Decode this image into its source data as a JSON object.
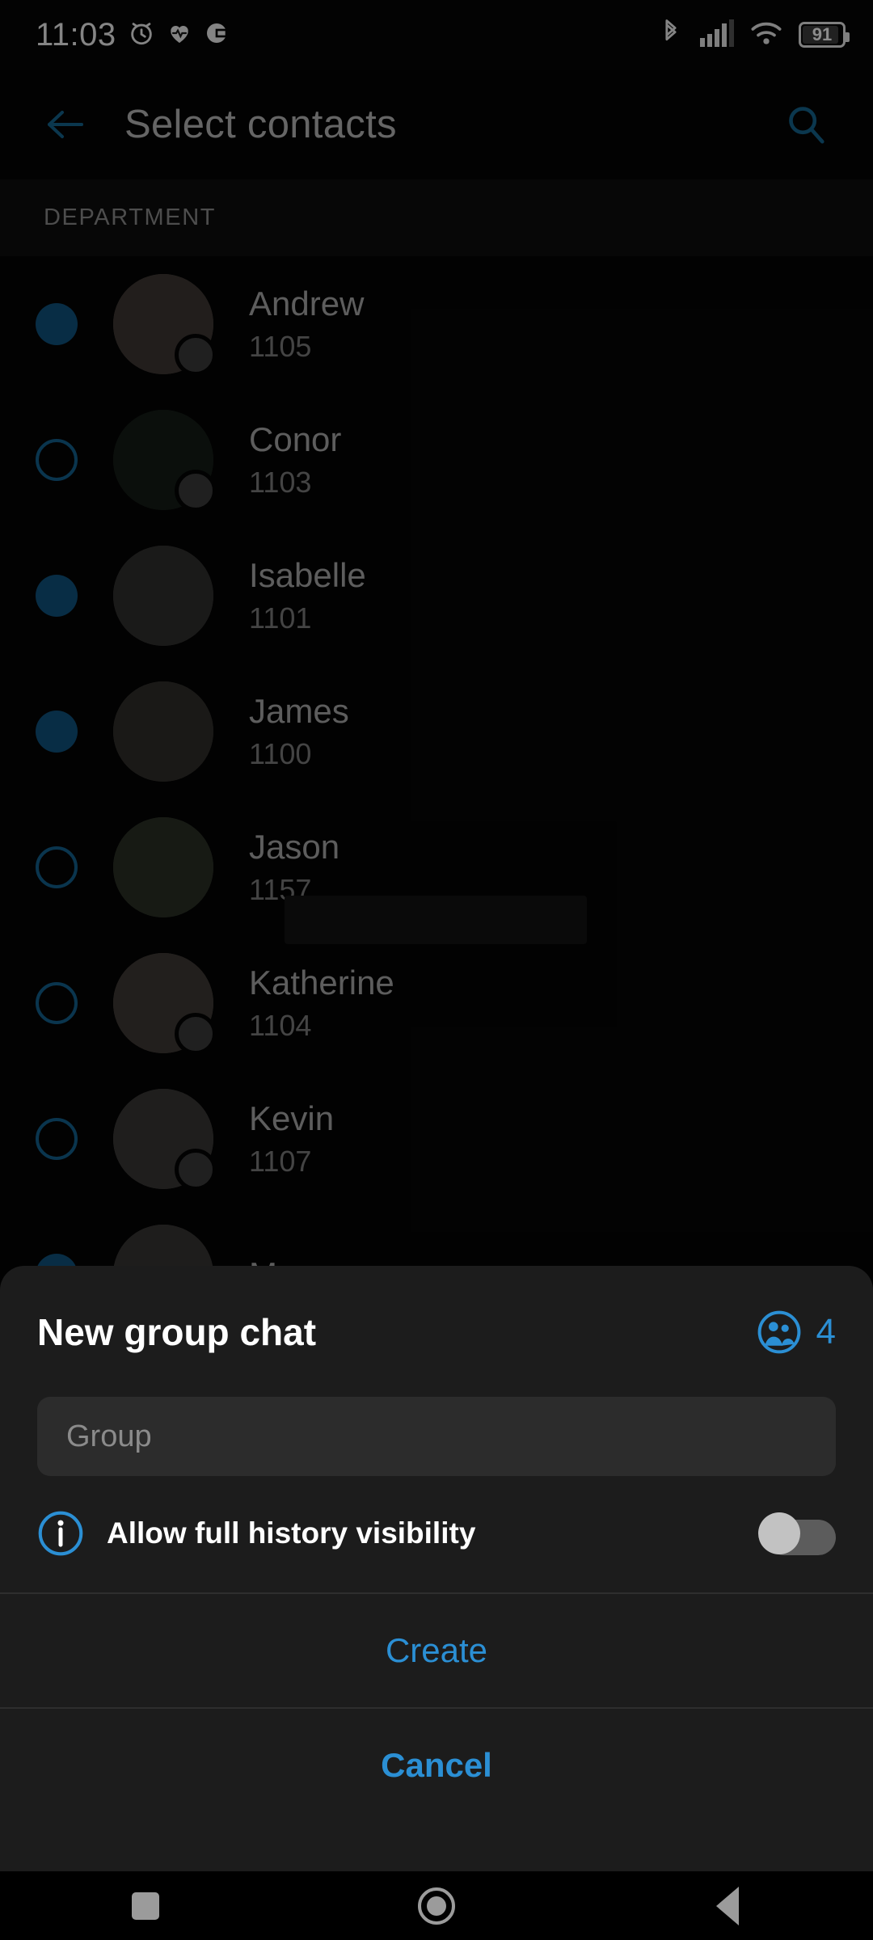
{
  "status_bar": {
    "time": "11:03",
    "battery_level": "91",
    "left_icons": [
      "alarm-clock-icon",
      "heart-pulse-icon",
      "do-not-disturb-icon"
    ],
    "right_icons": [
      "bluetooth-icon",
      "cellular-signal-icon",
      "wifi-icon",
      "battery-icon"
    ]
  },
  "app_bar": {
    "title": "Select contacts",
    "back_icon": "arrow-left-icon",
    "search_icon": "search-icon",
    "accent": "#14658f"
  },
  "section": {
    "label": "DEPARTMENT"
  },
  "contacts": [
    {
      "name": "Andrew",
      "extension": "1105",
      "selected": true,
      "badge": true,
      "avatar_bg": "#8c7c74"
    },
    {
      "name": "Conor",
      "extension": "1103",
      "selected": false,
      "badge": true,
      "avatar_bg": "#2e4032"
    },
    {
      "name": "Isabelle",
      "extension": "1101",
      "selected": true,
      "badge": false,
      "avatar_bg": "#6e6a68"
    },
    {
      "name": "James",
      "extension": "1100",
      "selected": true,
      "badge": false,
      "avatar_bg": "#6a665f"
    },
    {
      "name": "Jason",
      "extension": "1157",
      "selected": false,
      "badge": false,
      "avatar_bg": "#5d6b55"
    },
    {
      "name": "Katherine",
      "extension": "1104",
      "selected": false,
      "badge": true,
      "avatar_bg": "#8d8076"
    },
    {
      "name": "Kevin",
      "extension": "1107",
      "selected": false,
      "badge": true,
      "avatar_bg": "#7e7a78"
    },
    {
      "name": "Marcus",
      "extension": "",
      "selected": true,
      "badge": false,
      "avatar_bg": "#7b7774"
    }
  ],
  "dialog": {
    "title": "New group chat",
    "members_icon": "group-people-icon",
    "members_count": "4",
    "group_name_value": "",
    "group_name_placeholder": "Group",
    "info_icon": "info-circle-icon",
    "history_label": "Allow full history visibility",
    "history_enabled": false,
    "create_label": "Create",
    "cancel_label": "Cancel",
    "accent": "#2b8fd4"
  },
  "nav_bar": {
    "recents_icon": "square-recents-icon",
    "home_icon": "circle-home-icon",
    "back_icon": "triangle-back-icon"
  }
}
